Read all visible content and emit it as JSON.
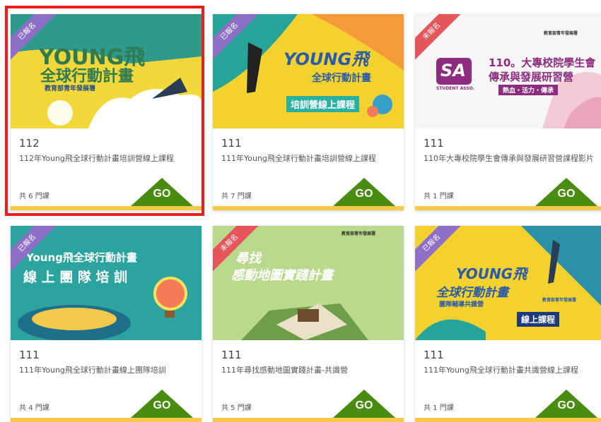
{
  "courses": [
    {
      "badge": "已報名",
      "year": "112",
      "title": "112年Young飛全球行動計畫培訓營線上課程",
      "count": "共 6 門課",
      "go": "GO",
      "thumb": {
        "line1": "YOUNG飛",
        "line2": "全球行動計畫",
        "line3": "教育部青年發展署"
      }
    },
    {
      "badge": "已報名",
      "year": "111",
      "title": "111年Young飛全球行動計畫培訓營線上課程",
      "count": "共 7 門課",
      "go": "GO",
      "thumb": {
        "line1": "YOUNG飛",
        "line2": "全球行動計畫",
        "line3": "培訓營線上課程"
      }
    },
    {
      "badge": "未報名",
      "year": "111",
      "title": "110年大專校院學生會傳承與發展研習營課程影片",
      "count": "共 1 門課",
      "go": "GO",
      "thumb": {
        "line1": "110。大專校院學生會",
        "line2": "傳承與發展研習營",
        "line3": "熱血・活力・傳承",
        "line4": "教育部青年發展署",
        "logo": "SA",
        "logo_sub": "STUDENT ASSO."
      }
    },
    {
      "badge": "已報名",
      "year": "111",
      "title": "111年Young飛全球行動計畫線上團隊培訓",
      "count": "共 4 門課",
      "go": "GO",
      "thumb": {
        "line1": "Young飛全球行動計畫",
        "line2": "線 上 團 隊 培 訓"
      }
    },
    {
      "badge": "未報名",
      "year": "111",
      "title": "111年尋找感動地圖實踐計畫-共識營",
      "count": "共 5 門課",
      "go": "GO",
      "thumb": {
        "line1": "尋找",
        "line2": "感動地圖實踐計畫",
        "line3": "教育部青年發展署"
      }
    },
    {
      "badge": "已報名",
      "year": "111",
      "title": "111年Young飛全球行動計畫共識營線上課程",
      "count": "共 1 門課",
      "go": "GO",
      "thumb": {
        "line1": "YOUNG飛",
        "line2": "全球行動計畫",
        "line3": "團隊輔導共識營",
        "line4": "線上課程",
        "line5": "教育部青年發展署"
      }
    }
  ],
  "colors": {
    "highlight": "#ee1c1c",
    "go_button": "#4a8c12",
    "badge_registered": "#8e6fc7",
    "badge_unregistered": "#e5555a",
    "bottom_bar": "#f7c948"
  }
}
